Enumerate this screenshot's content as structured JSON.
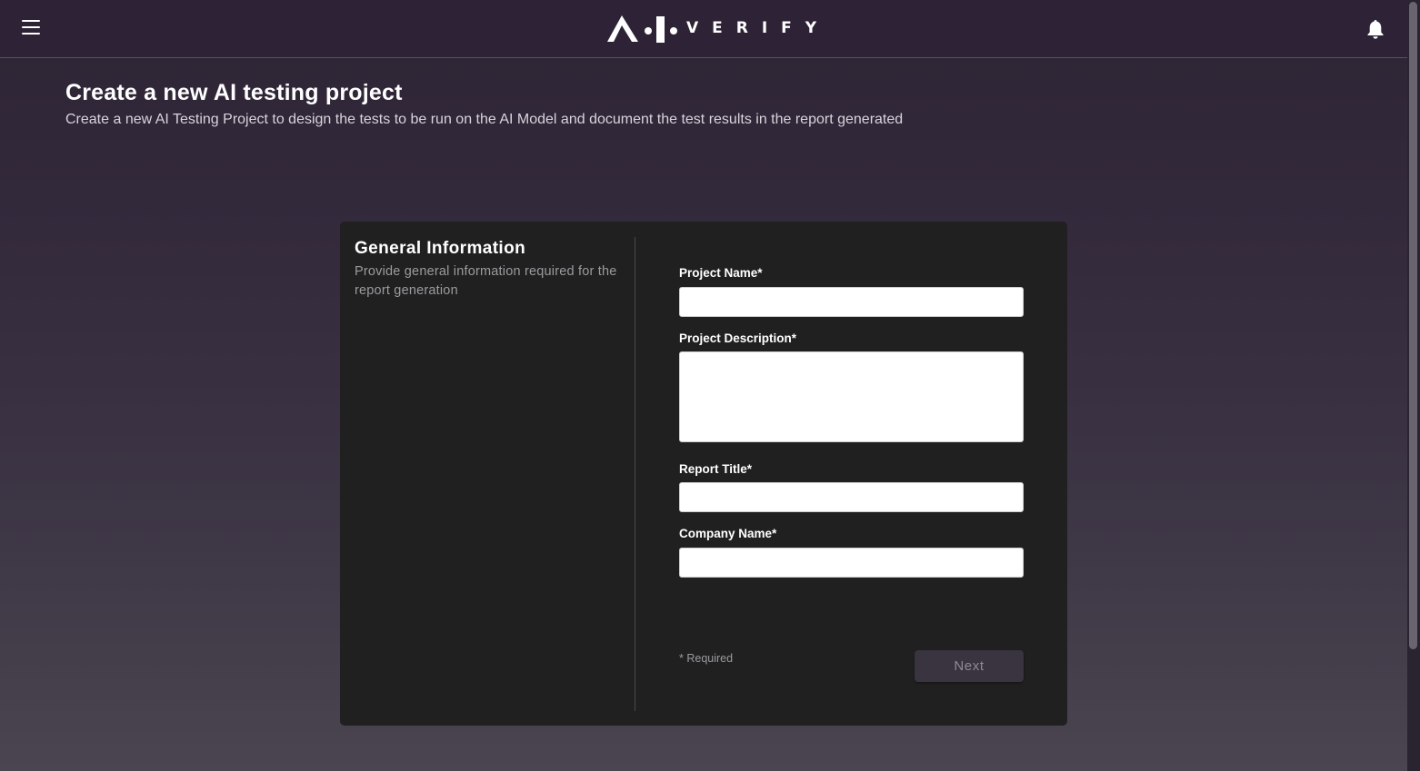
{
  "header": {
    "menu_icon": "hamburger-menu-icon",
    "logo_text": "VERIFY",
    "notification_icon": "bell-icon"
  },
  "page": {
    "title": "Create a new AI testing project",
    "subtitle": "Create a new AI Testing Project to design the tests to be run on the AI Model and document the test results in the report generated"
  },
  "form": {
    "section_title": "General Information",
    "section_description": "Provide general information required for the report generation",
    "fields": [
      {
        "label": "Project Name*",
        "value": ""
      },
      {
        "label": "Project Description*",
        "value": ""
      },
      {
        "label": "Report Title*",
        "value": ""
      },
      {
        "label": "Company Name*",
        "value": ""
      }
    ],
    "required_note": "* Required",
    "next_label": "Next"
  },
  "colors": {
    "background_top": "#2d2434",
    "background_bottom": "#4a4550",
    "card": "#202020",
    "button_disabled": "#3a3340"
  }
}
